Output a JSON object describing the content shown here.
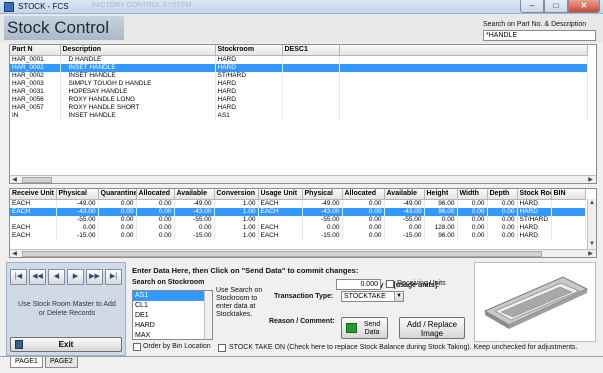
{
  "window": {
    "title": "STOCK - FCS",
    "ghost_text": "FACTORY CONTROL SYSTEM",
    "min_label": "–",
    "max_label": "□",
    "close_label": "✕"
  },
  "header": {
    "title": "Stock Control",
    "search_label": "Search on Part No. & Description",
    "search_value": "*HANDLE"
  },
  "parts": {
    "columns": [
      "Part N",
      "Description",
      "Stockroom",
      "DESC1"
    ],
    "rows": [
      [
        "HAR_0001",
        "D HANDLE",
        "HARD",
        ""
      ],
      [
        "HAR_0002",
        "INSET HANDLE",
        "HARD",
        ""
      ],
      [
        "HAR_0002",
        "INSET HANDLE",
        "ST/HARD",
        ""
      ],
      [
        "HAR_0003",
        "SIMPLY TOUGH D HANDLE",
        "HARD",
        ""
      ],
      [
        "HAR_0031",
        "HOPESAY HANDLE",
        "HARD",
        ""
      ],
      [
        "HAR_0056",
        "ROXY HANDLE LONG",
        "HARD",
        ""
      ],
      [
        "HAR_0057",
        "ROXY HANDLE SHORT",
        "HARD",
        ""
      ],
      [
        "IN",
        "INSET HANDLE",
        "AS1",
        ""
      ]
    ],
    "selected_row": 1
  },
  "stock": {
    "columns": [
      "Receive Unit",
      "Physical",
      "Quarantine",
      "Allocated",
      "Available",
      "Conversion",
      "Usage Unit",
      "Physical",
      "Allocated",
      "Available",
      "Height",
      "Width",
      "Depth",
      "Stock Room",
      "BIN"
    ],
    "rows": [
      [
        "EACH",
        "-49.00",
        "0.00",
        "0.00",
        "-49.00",
        "1.00",
        "EACH",
        "-49.00",
        "0.00",
        "-49.00",
        "96.00",
        "0.00",
        "0.00",
        "HARD",
        ""
      ],
      [
        "EACH",
        "-43.00",
        "0.00",
        "0.00",
        "-43.00",
        "1.00",
        "EACH",
        "-43.00",
        "0.00",
        "-43.00",
        "96.00",
        "0.00",
        "0.00",
        "HARD",
        ""
      ],
      [
        "",
        "-55.00",
        "0.00",
        "0.00",
        "-55.00",
        "1.00",
        "",
        "-55.00",
        "0.00",
        "-55.00",
        "0.00",
        "0.00",
        "0.00",
        "ST/HARD",
        ""
      ],
      [
        "EACH",
        "0.00",
        "0.00",
        "0.00",
        "0.00",
        "1.00",
        "EACH",
        "0.00",
        "0.00",
        "0.00",
        "128.00",
        "0.00",
        "0.00",
        "HARD",
        ""
      ],
      [
        "EACH",
        "-15.00",
        "0.00",
        "0.00",
        "-15.00",
        "1.00",
        "EACH",
        "-15.00",
        "0.00",
        "-15.00",
        "96.00",
        "0.00",
        "0.00",
        "HARD",
        ""
      ]
    ],
    "selected_row": 1
  },
  "nav": {
    "buttons": [
      "|◀",
      "◀◀",
      "◀",
      "▶",
      "▶▶",
      "▶|"
    ],
    "hint": "Use Stock Room Master to Add or Delete Records",
    "exit_label": "Exit"
  },
  "entry": {
    "instructions": "Enter Data Here, then Click on \"Send Data\" to commit changes:",
    "search_stockroom_label": "Search on Stockroom",
    "stockrooms": [
      "AS1",
      "CL1",
      "DE1",
      "HARD",
      "MAX"
    ],
    "selected_stockroom": 0,
    "help_text": "Use Search on Stockroom to enter data at Stocktakes.",
    "order_by_bin_label": "Order by Bin Location",
    "quantity_label": "Quantity in [usage units]:",
    "quantity_value": "0.000",
    "receiving_units_label": "Receiving Units",
    "transaction_type_label": "Transaction Type:",
    "transaction_type_value": "STOCKTAKE",
    "reason_label": "Reason / Comment:",
    "send_label": "Send Data",
    "add_image_label": "Add / Replace Image",
    "stocktake_label": "STOCK TAKE ON (Check here to replace Stock Balance during Stock Taking). Keep unchecked for adjustments."
  },
  "tabs": [
    "PAGE1",
    "PAGE2"
  ],
  "active_tab": 0,
  "colors": {
    "selection": "#3399ff",
    "header_panel": "#cfd9e8"
  }
}
